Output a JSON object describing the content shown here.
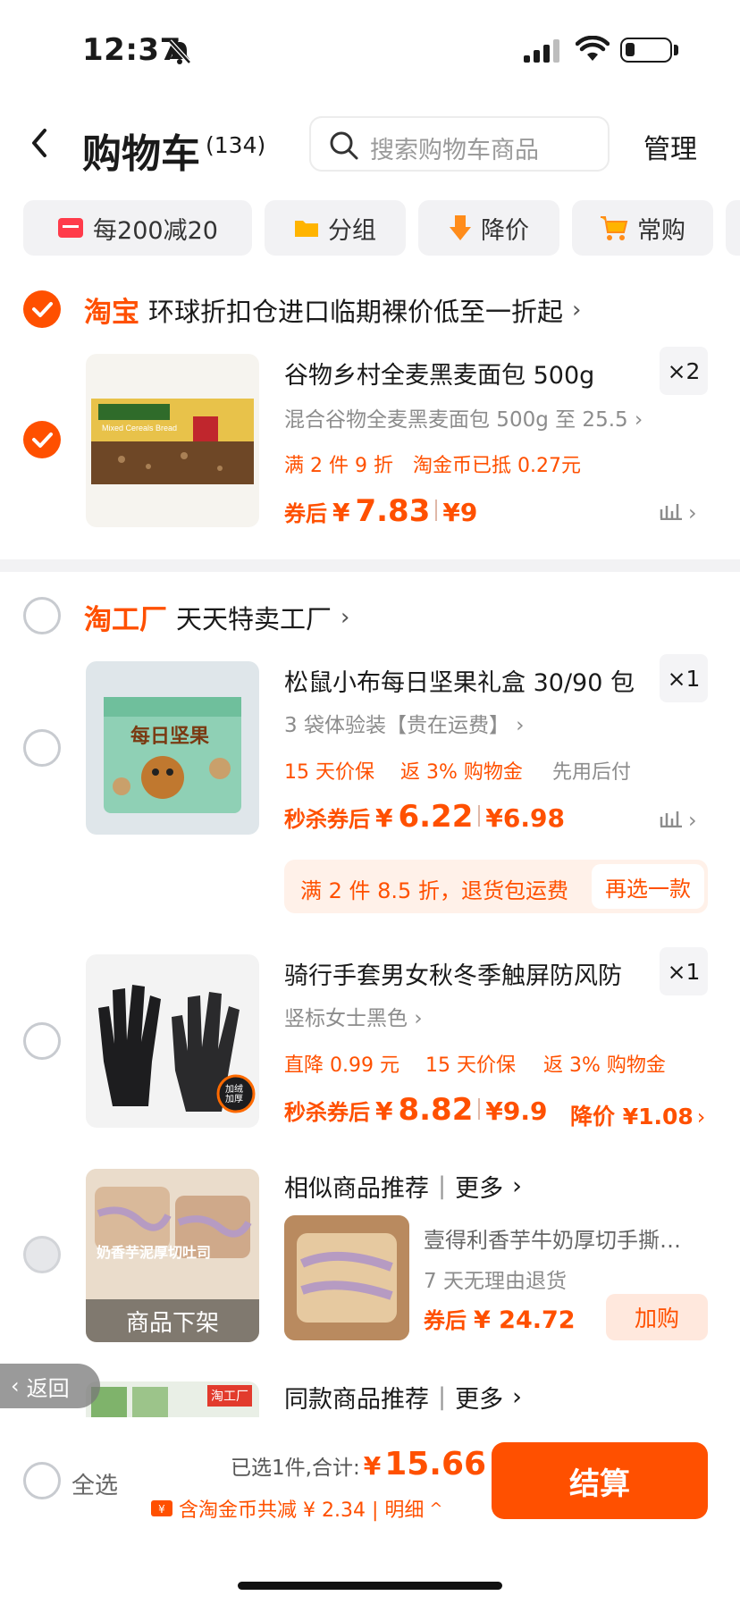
{
  "status": {
    "time": "12:37"
  },
  "header": {
    "title": "购物车",
    "count": "(134)",
    "search_placeholder": "搜索购物车商品",
    "manage": "管理"
  },
  "chips": [
    {
      "label": "每200减20",
      "icon": "coupon-icon"
    },
    {
      "label": "分组",
      "icon": "folder-icon"
    },
    {
      "label": "降价",
      "icon": "price-down-icon"
    },
    {
      "label": "常购",
      "icon": "cart-icon"
    }
  ],
  "shop1": {
    "brand": "淘宝",
    "name": "环球折扣仓进口临期裸价低至一折起",
    "checked": true
  },
  "item1": {
    "title": "谷物乡村全麦黑麦面包 500g",
    "qty": "×2",
    "sku": "混合谷物全麦黑麦面包 500g 至 25.5",
    "promo1": "满 2 件 9 折",
    "promo2": "淘金币已抵 0.27元",
    "price_prefix": "券后",
    "price_currency": "¥",
    "price": "7.83",
    "orig": "¥9",
    "img_text": "Mixed Cereals Bread",
    "checked": true
  },
  "shop2": {
    "brand": "淘工厂",
    "name": "天天特卖工厂",
    "checked": false
  },
  "item2": {
    "title": "松鼠小布每日坚果礼盒 30/90 包",
    "qty": "×1",
    "sku": "3 袋体验装【贵在运费】",
    "promo1": "15 天价保",
    "promo2": "返 3% 购物金",
    "promo3": "先用后付",
    "price_prefix": "秒杀券后",
    "price_currency": "¥",
    "price": "6.22",
    "orig": "¥6.98",
    "img_text": "每日坚果"
  },
  "banner": {
    "text": "满 2 件 8.5 折，退货包运费",
    "button": "再选一款"
  },
  "item3": {
    "title": "骑行手套男女秋冬季触屏防风防",
    "qty": "×1",
    "sku": "竖标女士黑色",
    "promo1": "直降 0.99 元",
    "promo2": "15 天价保",
    "promo3": "返 3% 购物金",
    "price_prefix": "秒杀券后",
    "price_currency": "¥",
    "price": "8.82",
    "orig": "¥9.9",
    "drop": "降价 ¥1.08",
    "badge": "加绒加厚"
  },
  "item4": {
    "unavailable": "商品下架",
    "img_text": "奶香芋泥厚切吐司",
    "similar_title": "相似商品推荐",
    "more": "更多",
    "rec_title": "壹得利香芋牛奶厚切手撕…",
    "rec_sub": "7 天无理由退货",
    "rec_price_prefix": "券后",
    "rec_price": "¥ 24.72",
    "add": "加购"
  },
  "item5": {
    "title": "同款商品推荐",
    "more": "更多",
    "img_text": "淘工厂"
  },
  "floating": {
    "back": "返回"
  },
  "footer": {
    "select_all": "全选",
    "selected": "已选1件,合计:",
    "total_currency": "¥",
    "total": "15.66",
    "discount": "含淘金币共减 ¥ 2.34 | 明细",
    "checkout": "结算"
  }
}
